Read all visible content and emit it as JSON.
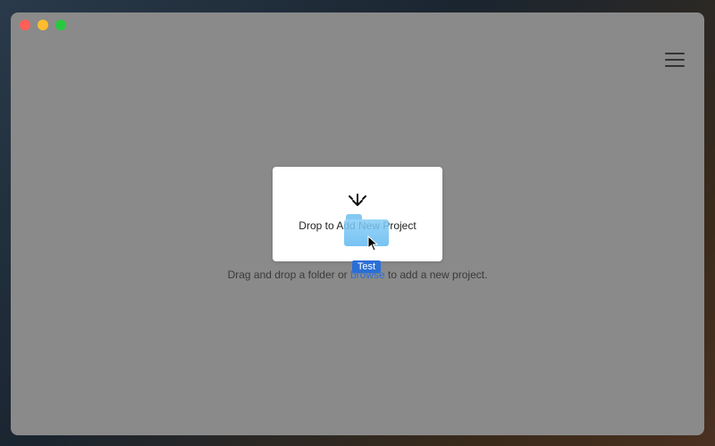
{
  "drop_card": {
    "label": "Drop to Add New Project"
  },
  "hint": {
    "prefix": "Drag and drop a folder or ",
    "browse": "browse",
    "suffix": " to add a new project."
  },
  "dragged_item": {
    "name": "Test"
  }
}
